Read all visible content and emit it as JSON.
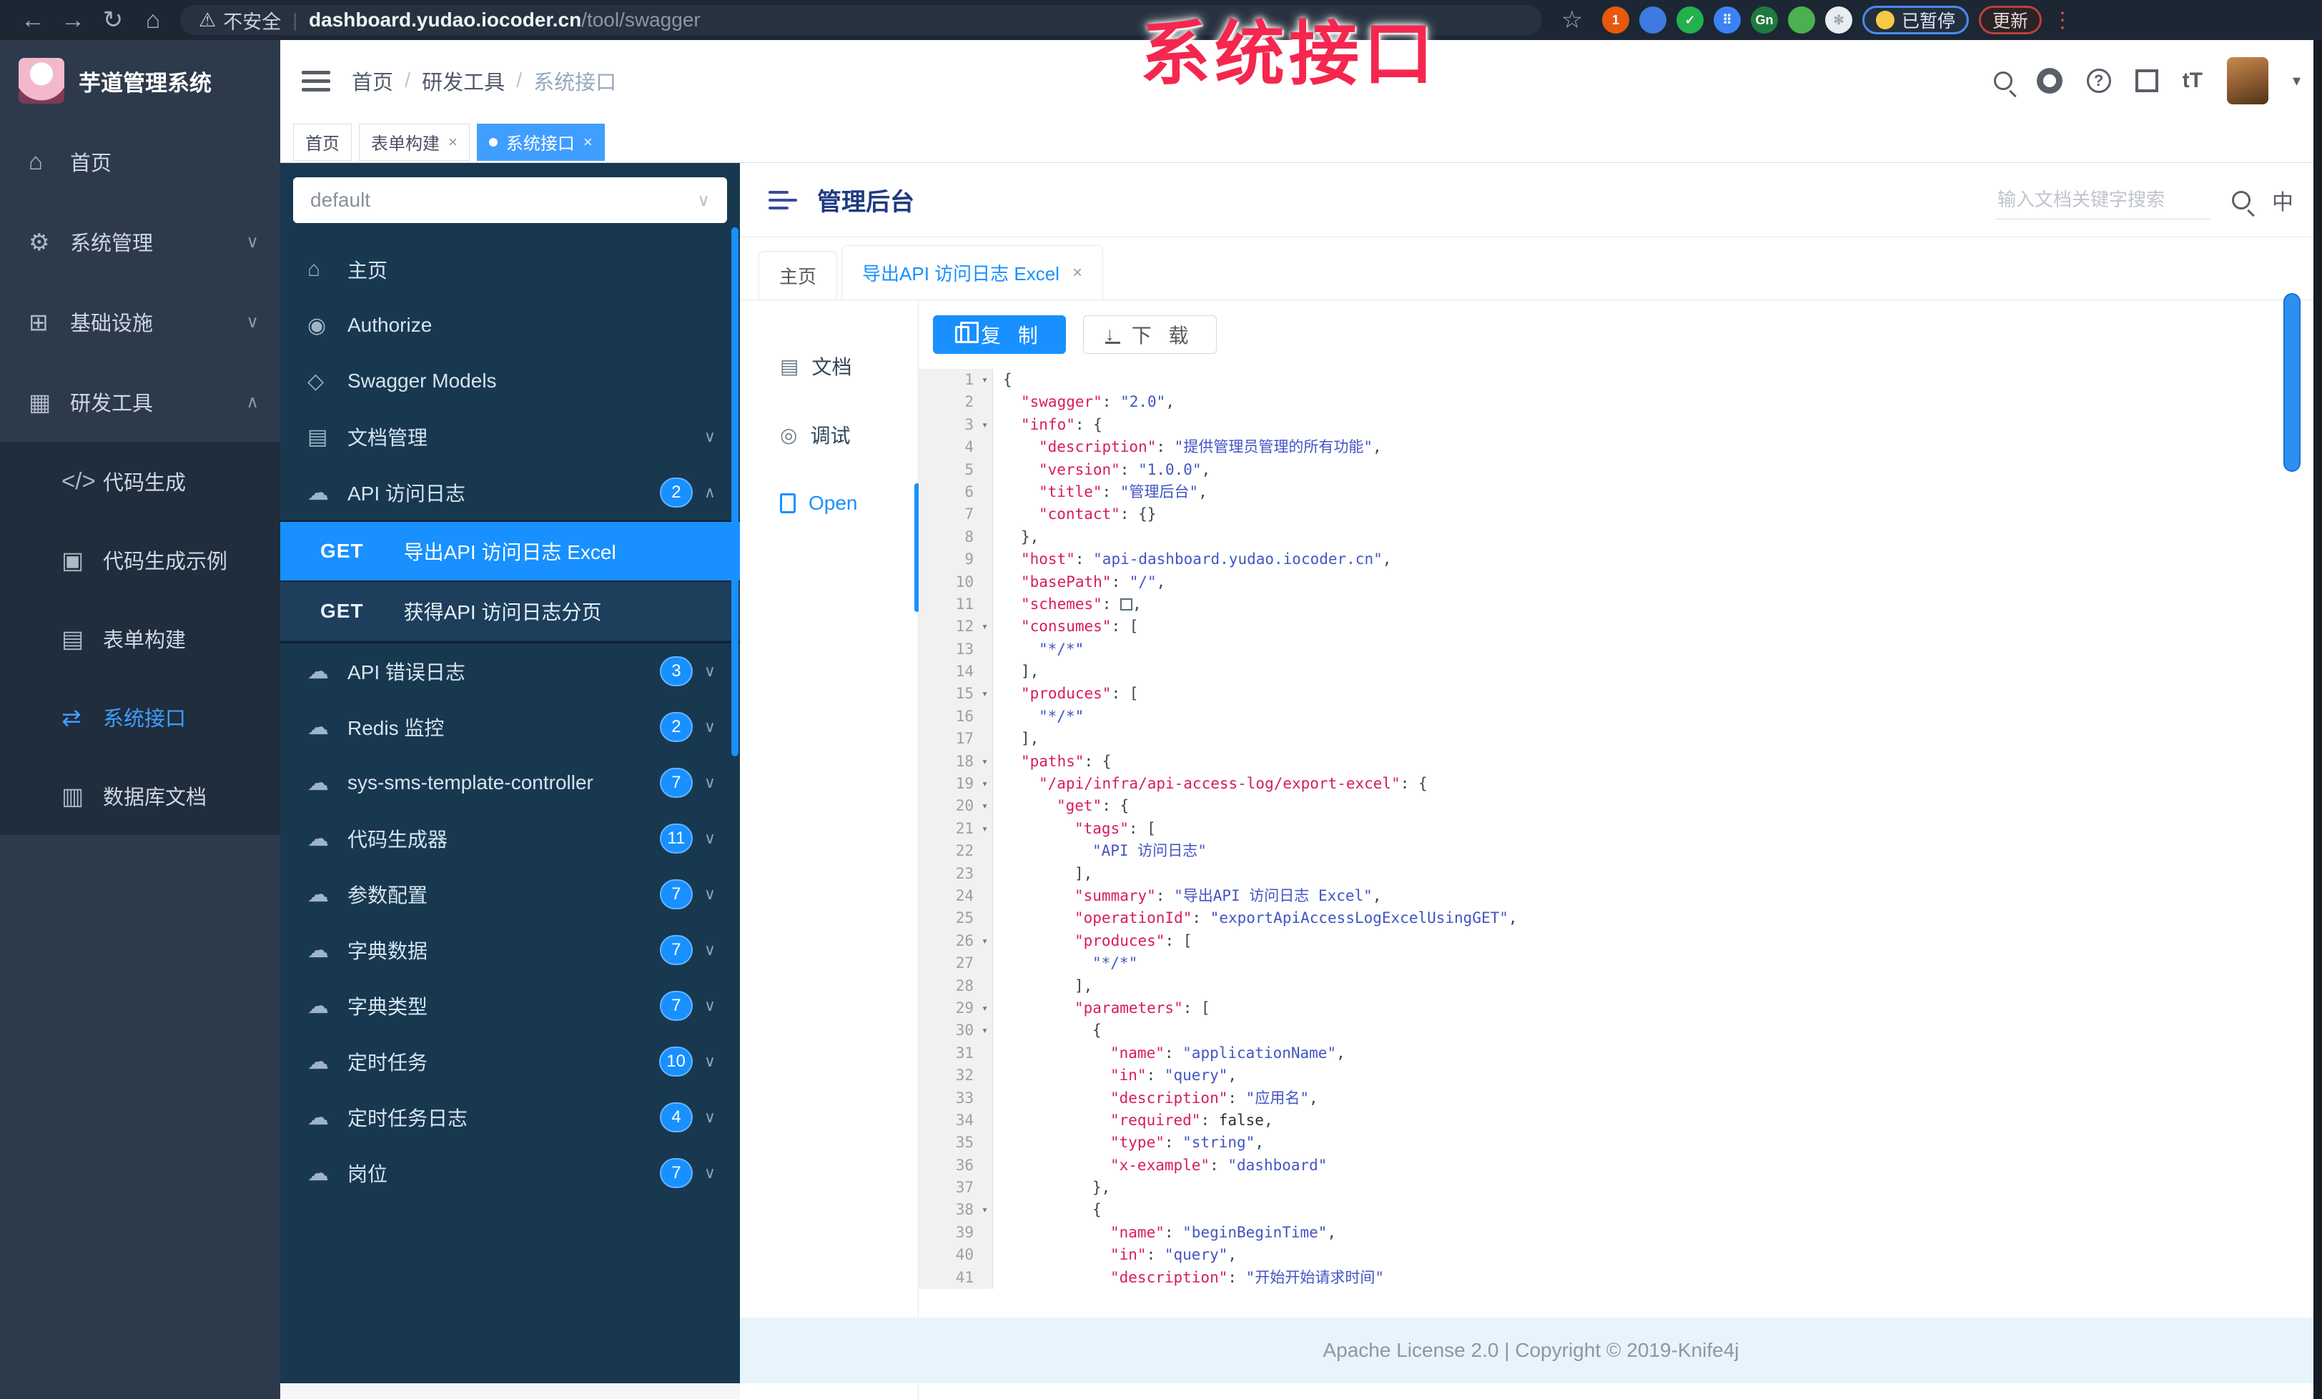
{
  "browser": {
    "back_icon": "←",
    "forward_icon": "→",
    "reload_icon": "↻",
    "home_icon": "⌂",
    "warning_icon": "⚠",
    "security_label": "不安全",
    "url_host": "dashboard.yudao.iocoder.cn",
    "url_path": "/tool/swagger",
    "bookmark_icon": "☆",
    "extensions": [
      {
        "bg": "#e8590c",
        "text": "1"
      },
      {
        "bg": "#3f7ae0",
        "text": ""
      },
      {
        "bg": "#23b14d",
        "text": "✓"
      },
      {
        "bg": "#3b82f6",
        "text": "⠿"
      },
      {
        "bg": "#1f7a3f",
        "text": "Gn"
      },
      {
        "bg": "#4caf50",
        "text": ""
      },
      {
        "bg": "#e9edf1",
        "text": "✻"
      }
    ],
    "paused_label": "已暂停",
    "update_label": "更新",
    "menu_dots": "⋮"
  },
  "watermark": "系统接口",
  "app": {
    "logo_title": "芋道管理系统",
    "breadcrumb": {
      "items": [
        "首页",
        "研发工具",
        "系统接口"
      ],
      "separator": "/"
    },
    "sidebar": {
      "items": [
        {
          "icon": "⌂",
          "label": "首页"
        },
        {
          "icon": "⚙",
          "label": "系统管理",
          "arrow": "∨"
        },
        {
          "icon": "⊞",
          "label": "基础设施",
          "arrow": "∨"
        },
        {
          "icon": "▦",
          "label": "研发工具",
          "arrow": "∧",
          "children": [
            {
              "icon": "</>",
              "label": "代码生成"
            },
            {
              "icon": "▣",
              "label": "代码生成示例"
            },
            {
              "icon": "▤",
              "label": "表单构建"
            },
            {
              "icon": "⇄",
              "label": "系统接口",
              "active": true
            },
            {
              "icon": "▥",
              "label": "数据库文档"
            }
          ]
        }
      ]
    },
    "tags": [
      {
        "label": "首页"
      },
      {
        "label": "表单构建",
        "closable": true
      },
      {
        "label": "系统接口",
        "closable": true,
        "active": true
      }
    ]
  },
  "swagger_panel": {
    "group_select": "default",
    "select_caret": "∨",
    "menu": [
      {
        "icon": "⌂",
        "label": "主页"
      },
      {
        "icon": "◉",
        "label": "Authorize"
      },
      {
        "icon": "◇",
        "label": "Swagger Models"
      },
      {
        "icon": "▤",
        "label": "文档管理",
        "arrow": "∨"
      },
      {
        "icon": "☁",
        "label": "API 访问日志",
        "badge": "2",
        "arrow": "∧",
        "children": [
          {
            "method": "GET",
            "label": "导出API 访问日志 Excel",
            "active": true
          },
          {
            "method": "GET",
            "label": "获得API 访问日志分页"
          }
        ]
      },
      {
        "icon": "☁",
        "label": "API 错误日志",
        "badge": "3",
        "arrow": "∨"
      },
      {
        "icon": "☁",
        "label": "Redis 监控",
        "badge": "2",
        "arrow": "∨"
      },
      {
        "icon": "☁",
        "label": "sys-sms-template-controller",
        "badge": "7",
        "arrow": "∨"
      },
      {
        "icon": "☁",
        "label": "代码生成器",
        "badge": "11",
        "arrow": "∨"
      },
      {
        "icon": "☁",
        "label": "参数配置",
        "badge": "7",
        "arrow": "∨"
      },
      {
        "icon": "☁",
        "label": "字典数据",
        "badge": "7",
        "arrow": "∨"
      },
      {
        "icon": "☁",
        "label": "字典类型",
        "badge": "7",
        "arrow": "∨"
      },
      {
        "icon": "☁",
        "label": "定时任务",
        "badge": "10",
        "arrow": "∨"
      },
      {
        "icon": "☁",
        "label": "定时任务日志",
        "badge": "4",
        "arrow": "∨"
      },
      {
        "icon": "☁",
        "label": "岗位",
        "badge": "7",
        "arrow": "∨"
      }
    ]
  },
  "doc_panel": {
    "title": "管理后台",
    "search_placeholder": "输入文档关键字搜索",
    "lang_icon": "中",
    "tabs": [
      {
        "label": "主页"
      },
      {
        "label": "导出API 访问日志 Excel",
        "closable": true,
        "active": true
      }
    ],
    "side_tabs": [
      {
        "icon": "▤",
        "label": "文档"
      },
      {
        "icon": "◎",
        "label": "调试"
      },
      {
        "icon": "file",
        "label": "Open",
        "active": true
      }
    ],
    "copy_label": "复 制",
    "download_label": "下 载",
    "download_icon": "↓",
    "footer": "Apache License 2.0 | Copyright © 2019-Knife4j"
  },
  "code": {
    "lines": [
      {
        "n": 1,
        "f": 1,
        "i": 0,
        "t": [
          [
            "p",
            "{"
          ]
        ]
      },
      {
        "n": 2,
        "f": 0,
        "i": 1,
        "t": [
          [
            "k",
            "\"swagger\""
          ],
          [
            "p",
            ": "
          ],
          [
            "s",
            "\"2.0\""
          ],
          [
            "p",
            ","
          ]
        ]
      },
      {
        "n": 3,
        "f": 1,
        "i": 1,
        "t": [
          [
            "k",
            "\"info\""
          ],
          [
            "p",
            ": {"
          ]
        ]
      },
      {
        "n": 4,
        "f": 0,
        "i": 2,
        "t": [
          [
            "k",
            "\"description\""
          ],
          [
            "p",
            ": "
          ],
          [
            "s",
            "\"提供管理员管理的所有功能\""
          ],
          [
            "p",
            ","
          ]
        ]
      },
      {
        "n": 5,
        "f": 0,
        "i": 2,
        "t": [
          [
            "k",
            "\"version\""
          ],
          [
            "p",
            ": "
          ],
          [
            "s",
            "\"1.0.0\""
          ],
          [
            "p",
            ","
          ]
        ]
      },
      {
        "n": 6,
        "f": 0,
        "i": 2,
        "t": [
          [
            "k",
            "\"title\""
          ],
          [
            "p",
            ": "
          ],
          [
            "s",
            "\"管理后台\""
          ],
          [
            "p",
            ","
          ]
        ]
      },
      {
        "n": 7,
        "f": 0,
        "i": 2,
        "t": [
          [
            "k",
            "\"contact\""
          ],
          [
            "p",
            ": {}"
          ]
        ]
      },
      {
        "n": 8,
        "f": 0,
        "i": 1,
        "t": [
          [
            "p",
            "},"
          ]
        ]
      },
      {
        "n": 9,
        "f": 0,
        "i": 1,
        "t": [
          [
            "k",
            "\"host\""
          ],
          [
            "p",
            ": "
          ],
          [
            "s",
            "\"api-dashboard.yudao.iocoder.cn\""
          ],
          [
            "p",
            ","
          ]
        ]
      },
      {
        "n": 10,
        "f": 0,
        "i": 1,
        "t": [
          [
            "k",
            "\"basePath\""
          ],
          [
            "p",
            ": "
          ],
          [
            "s",
            "\"/\""
          ],
          [
            "p",
            ","
          ]
        ]
      },
      {
        "n": 11,
        "f": 0,
        "i": 1,
        "t": [
          [
            "k",
            "\"schemes\""
          ],
          [
            "p",
            ": "
          ],
          [
            "sq",
            ""
          ],
          [
            "p",
            ","
          ]
        ]
      },
      {
        "n": 12,
        "f": 1,
        "i": 1,
        "t": [
          [
            "k",
            "\"consumes\""
          ],
          [
            "p",
            ": ["
          ]
        ]
      },
      {
        "n": 13,
        "f": 0,
        "i": 2,
        "t": [
          [
            "s",
            "\"*/*\""
          ]
        ]
      },
      {
        "n": 14,
        "f": 0,
        "i": 1,
        "t": [
          [
            "p",
            "],"
          ]
        ]
      },
      {
        "n": 15,
        "f": 1,
        "i": 1,
        "t": [
          [
            "k",
            "\"produces\""
          ],
          [
            "p",
            ": ["
          ]
        ]
      },
      {
        "n": 16,
        "f": 0,
        "i": 2,
        "t": [
          [
            "s",
            "\"*/*\""
          ]
        ]
      },
      {
        "n": 17,
        "f": 0,
        "i": 1,
        "t": [
          [
            "p",
            "],"
          ]
        ]
      },
      {
        "n": 18,
        "f": 1,
        "i": 1,
        "t": [
          [
            "k",
            "\"paths\""
          ],
          [
            "p",
            ": {"
          ]
        ]
      },
      {
        "n": 19,
        "f": 1,
        "i": 2,
        "t": [
          [
            "k",
            "\"/api/infra/api-access-log/export-excel\""
          ],
          [
            "p",
            ": {"
          ]
        ]
      },
      {
        "n": 20,
        "f": 1,
        "i": 3,
        "t": [
          [
            "k",
            "\"get\""
          ],
          [
            "p",
            ": {"
          ]
        ]
      },
      {
        "n": 21,
        "f": 1,
        "i": 4,
        "t": [
          [
            "k",
            "\"tags\""
          ],
          [
            "p",
            ": ["
          ]
        ]
      },
      {
        "n": 22,
        "f": 0,
        "i": 5,
        "t": [
          [
            "s",
            "\"API 访问日志\""
          ]
        ]
      },
      {
        "n": 23,
        "f": 0,
        "i": 4,
        "t": [
          [
            "p",
            "],"
          ]
        ]
      },
      {
        "n": 24,
        "f": 0,
        "i": 4,
        "t": [
          [
            "k",
            "\"summary\""
          ],
          [
            "p",
            ": "
          ],
          [
            "s",
            "\"导出API 访问日志 Excel\""
          ],
          [
            "p",
            ","
          ]
        ]
      },
      {
        "n": 25,
        "f": 0,
        "i": 4,
        "t": [
          [
            "k",
            "\"operationId\""
          ],
          [
            "p",
            ": "
          ],
          [
            "s",
            "\"exportApiAccessLogExcelUsingGET\""
          ],
          [
            "p",
            ","
          ]
        ]
      },
      {
        "n": 26,
        "f": 1,
        "i": 4,
        "t": [
          [
            "k",
            "\"produces\""
          ],
          [
            "p",
            ": ["
          ]
        ]
      },
      {
        "n": 27,
        "f": 0,
        "i": 5,
        "t": [
          [
            "s",
            "\"*/*\""
          ]
        ]
      },
      {
        "n": 28,
        "f": 0,
        "i": 4,
        "t": [
          [
            "p",
            "],"
          ]
        ]
      },
      {
        "n": 29,
        "f": 1,
        "i": 4,
        "t": [
          [
            "k",
            "\"parameters\""
          ],
          [
            "p",
            ": ["
          ]
        ]
      },
      {
        "n": 30,
        "f": 1,
        "i": 5,
        "t": [
          [
            "p",
            "{"
          ]
        ]
      },
      {
        "n": 31,
        "f": 0,
        "i": 6,
        "t": [
          [
            "k",
            "\"name\""
          ],
          [
            "p",
            ": "
          ],
          [
            "s",
            "\"applicationName\""
          ],
          [
            "p",
            ","
          ]
        ]
      },
      {
        "n": 32,
        "f": 0,
        "i": 6,
        "t": [
          [
            "k",
            "\"in\""
          ],
          [
            "p",
            ": "
          ],
          [
            "s",
            "\"query\""
          ],
          [
            "p",
            ","
          ]
        ]
      },
      {
        "n": 33,
        "f": 0,
        "i": 6,
        "t": [
          [
            "k",
            "\"description\""
          ],
          [
            "p",
            ": "
          ],
          [
            "s",
            "\"应用名\""
          ],
          [
            "p",
            ","
          ]
        ]
      },
      {
        "n": 34,
        "f": 0,
        "i": 6,
        "t": [
          [
            "k",
            "\"required\""
          ],
          [
            "p",
            ": "
          ],
          [
            "b",
            "false"
          ],
          [
            "p",
            ","
          ]
        ]
      },
      {
        "n": 35,
        "f": 0,
        "i": 6,
        "t": [
          [
            "k",
            "\"type\""
          ],
          [
            "p",
            ": "
          ],
          [
            "s",
            "\"string\""
          ],
          [
            "p",
            ","
          ]
        ]
      },
      {
        "n": 36,
        "f": 0,
        "i": 6,
        "t": [
          [
            "k",
            "\"x-example\""
          ],
          [
            "p",
            ": "
          ],
          [
            "s",
            "\"dashboard\""
          ]
        ]
      },
      {
        "n": 37,
        "f": 0,
        "i": 5,
        "t": [
          [
            "p",
            "},"
          ]
        ]
      },
      {
        "n": 38,
        "f": 1,
        "i": 5,
        "t": [
          [
            "p",
            "{"
          ]
        ]
      },
      {
        "n": 39,
        "f": 0,
        "i": 6,
        "t": [
          [
            "k",
            "\"name\""
          ],
          [
            "p",
            ": "
          ],
          [
            "s",
            "\"beginBeginTime\""
          ],
          [
            "p",
            ","
          ]
        ]
      },
      {
        "n": 40,
        "f": 0,
        "i": 6,
        "t": [
          [
            "k",
            "\"in\""
          ],
          [
            "p",
            ": "
          ],
          [
            "s",
            "\"query\""
          ],
          [
            "p",
            ","
          ]
        ]
      },
      {
        "n": 41,
        "f": 0,
        "i": 6,
        "t": [
          [
            "k",
            "\"description\""
          ],
          [
            "p",
            ": "
          ],
          [
            "s",
            "\"开始开始请求时间\""
          ]
        ]
      }
    ]
  }
}
